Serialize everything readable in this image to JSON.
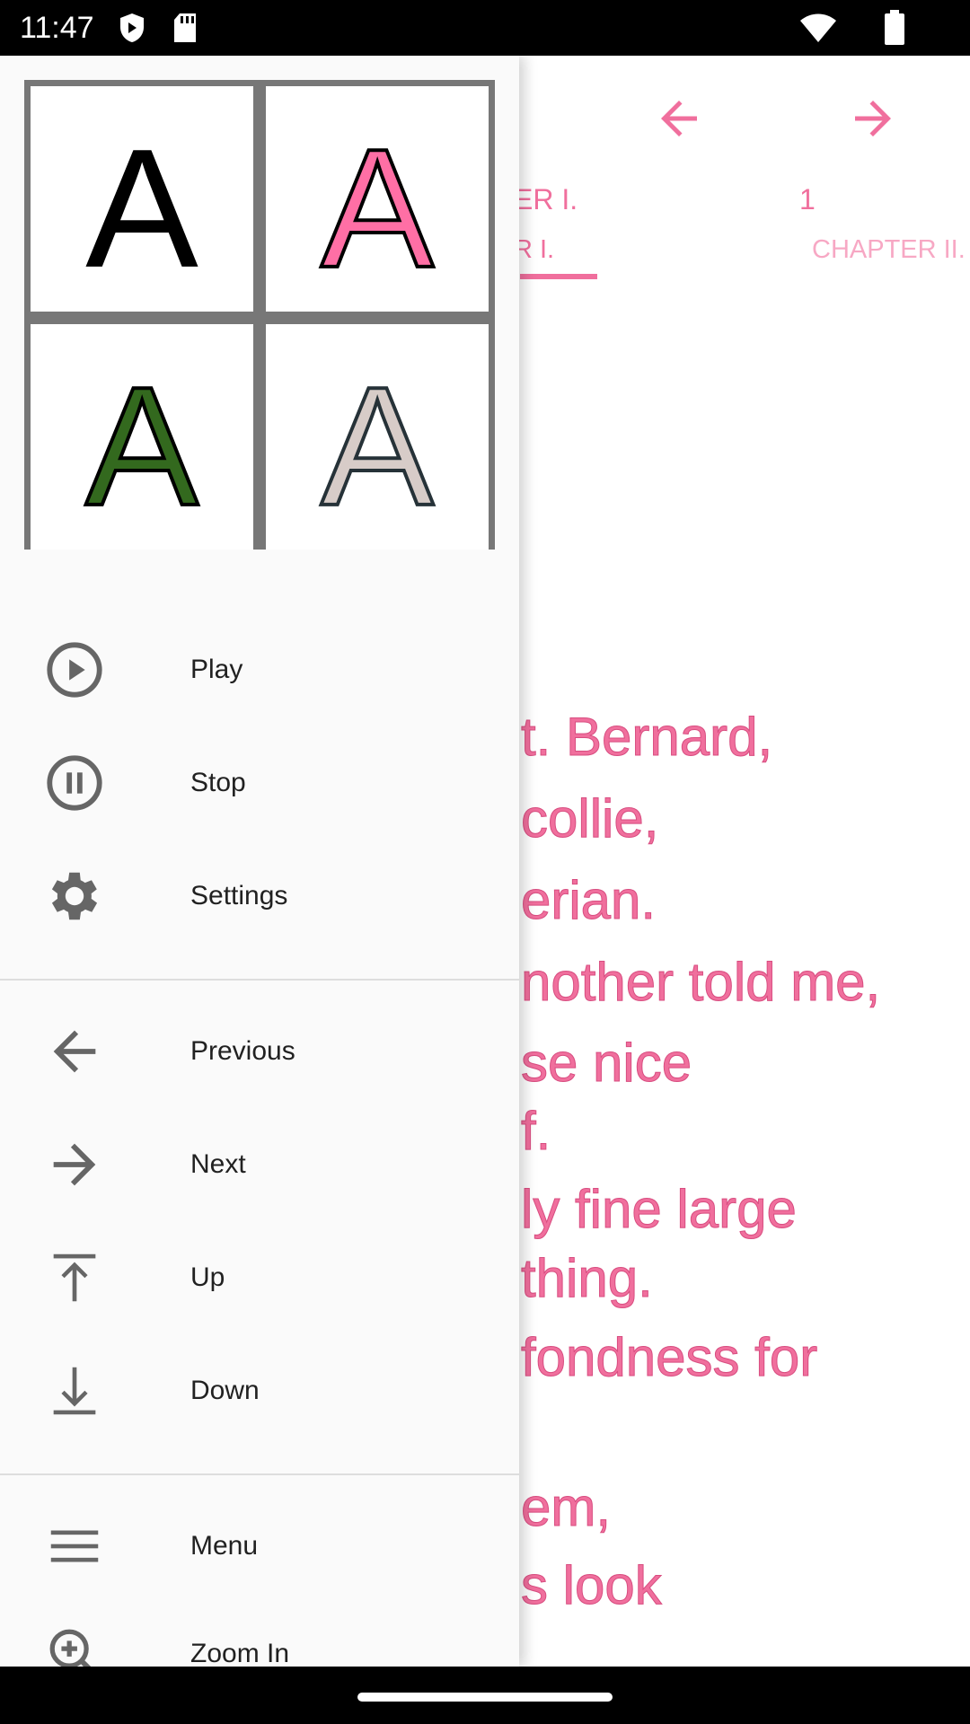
{
  "status_bar": {
    "time": "11:47",
    "icons": [
      "shield-icon",
      "sd-card-icon",
      "wifi-icon",
      "battery-icon"
    ]
  },
  "colors": {
    "accent": "#f06f9d",
    "drawer_bg": "#fafafa",
    "icon": "#666666"
  },
  "reader": {
    "prev_icon": "arrow-left-icon",
    "next_icon": "arrow-right-icon",
    "current_chapter_title": "ER I.",
    "page_number": "1",
    "tabs": [
      {
        "label": "R I.",
        "selected": true
      },
      {
        "label": "CHAPTER II.",
        "selected": false
      }
    ],
    "lines": [
      "t. Bernard,",
      "collie,",
      "erian.",
      "nother told me,",
      "se nice",
      "f.",
      "ly fine large",
      "thing.",
      "fondness for",
      "em,",
      "s look"
    ]
  },
  "drawer": {
    "font_styles": [
      {
        "letter": "A",
        "fill": "#000000",
        "stroke": "#000000"
      },
      {
        "letter": "A",
        "fill": "#ff6fa5",
        "stroke": "#000000"
      },
      {
        "letter": "A",
        "fill": "#33691e",
        "stroke": "#000000"
      },
      {
        "letter": "A",
        "fill": "#d7ccc8",
        "stroke": "#263238"
      }
    ],
    "group1": [
      {
        "label": "Play",
        "icon": "play-circle-icon"
      },
      {
        "label": "Stop",
        "icon": "pause-circle-icon"
      },
      {
        "label": "Settings",
        "icon": "gear-icon"
      }
    ],
    "group2": [
      {
        "label": "Previous",
        "icon": "arrow-left-icon"
      },
      {
        "label": "Next",
        "icon": "arrow-right-icon"
      },
      {
        "label": "Up",
        "icon": "arrow-up-bar-icon"
      },
      {
        "label": "Down",
        "icon": "arrow-down-bar-icon"
      }
    ],
    "group3": [
      {
        "label": "Menu",
        "icon": "menu-icon"
      },
      {
        "label": "Zoom In",
        "icon": "zoom-in-icon"
      }
    ]
  }
}
